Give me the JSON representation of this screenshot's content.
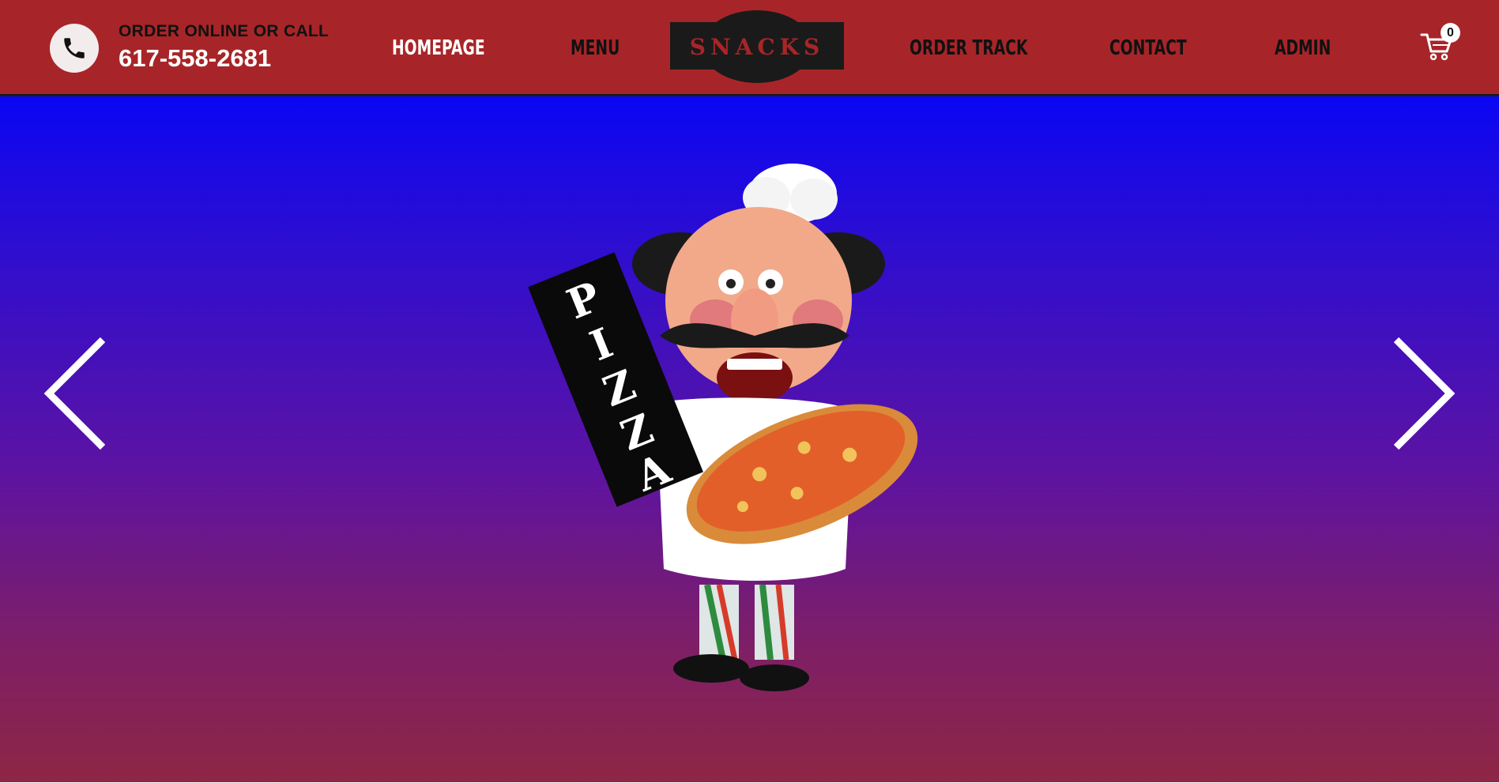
{
  "header": {
    "call_label": "ORDER ONLINE OR CALL",
    "phone": "617-558-2681",
    "phone_icon": "phone-icon",
    "logo_text": "SNACKS",
    "nav": {
      "home": "HOMEPAGE",
      "menu": "MENU",
      "order_track": "ORDER TRACK",
      "contact": "CONTACT",
      "admin": "ADMIN"
    },
    "cart_icon": "shopping-cart-icon",
    "cart_count": "0"
  },
  "hero": {
    "sign_text": "PIZZA",
    "prev_icon": "chevron-left-icon",
    "next_icon": "chevron-right-icon"
  },
  "colors": {
    "navbar": "#a72528",
    "hero_top": "#0a06f3",
    "hero_bottom": "#8e2644",
    "logo_bg": "#1a1a1a"
  }
}
